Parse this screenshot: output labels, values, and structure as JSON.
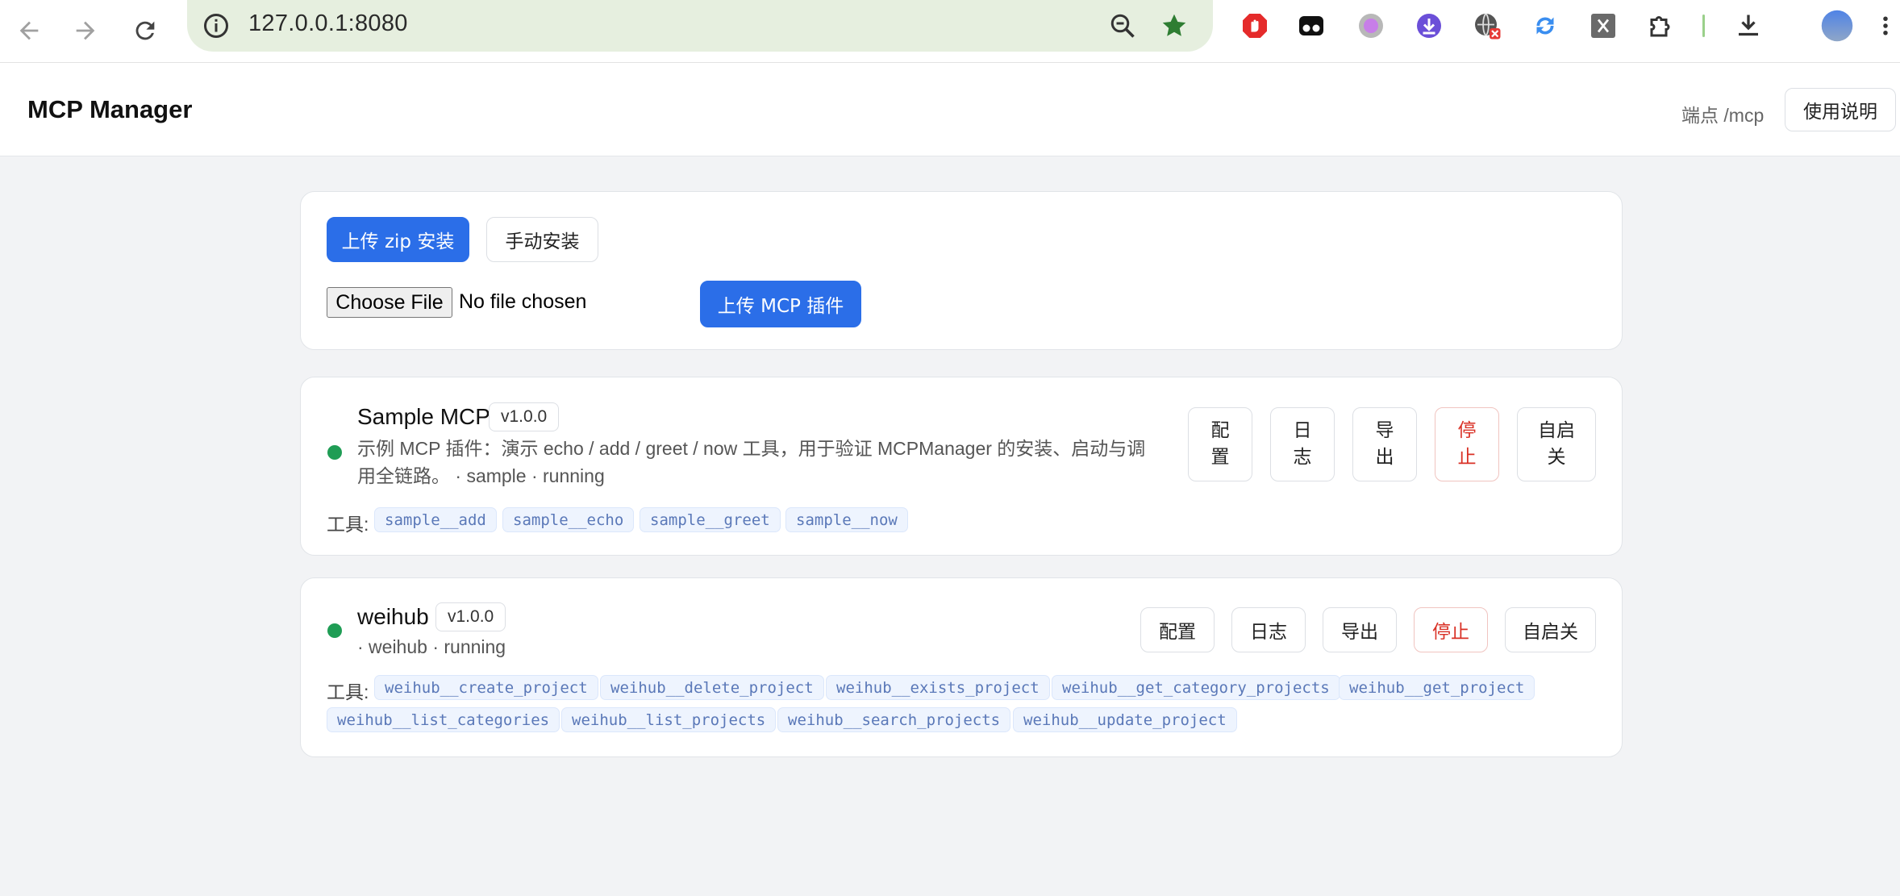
{
  "browser": {
    "url": "127.0.0.1:8080",
    "accent": "#e6efdf"
  },
  "header": {
    "title": "MCP Manager",
    "endpoint": "端点 /mcp",
    "help_label": "使用说明"
  },
  "upload": {
    "zip_install_label": "上传 zip 安装",
    "manual_install_label": "手动安装",
    "choose_file_label": "Choose File",
    "file_status": "No file chosen",
    "upload_plugin_label": "上传 MCP 插件"
  },
  "mcps": [
    {
      "name": "Sample MCP",
      "version": "v1.0.0",
      "status_color": "#1f9d55",
      "desc_line1": "示例 MCP 插件：演示 echo / add / greet / now 工具，用于验证 MCPManager 的安装、启动与调",
      "desc_line2": "用全链路。 · sample · running",
      "actions": {
        "config": [
          "配",
          "置"
        ],
        "logs": [
          "日",
          "志"
        ],
        "export": [
          "导",
          "出"
        ],
        "stop": [
          "停",
          "止"
        ],
        "autostart": [
          "自启",
          "关"
        ]
      },
      "tools_label": "工具:",
      "tools": [
        "sample__add",
        "sample__echo",
        "sample__greet",
        "sample__now"
      ]
    },
    {
      "name": "weihub",
      "version": "v1.0.0",
      "status_color": "#1f9d55",
      "desc_line1": "· weihub · running",
      "actions": {
        "config": "配置",
        "logs": "日志",
        "export": "导出",
        "stop": "停止",
        "autostart": "自启关"
      },
      "tools_label": "工具:",
      "tools": [
        "weihub__create_project",
        "weihub__delete_project",
        "weihub__exists_project",
        "weihub__get_category_projects",
        "weihub__get_project",
        "weihub__list_categories",
        "weihub__list_projects",
        "weihub__search_projects",
        "weihub__update_project"
      ]
    }
  ]
}
